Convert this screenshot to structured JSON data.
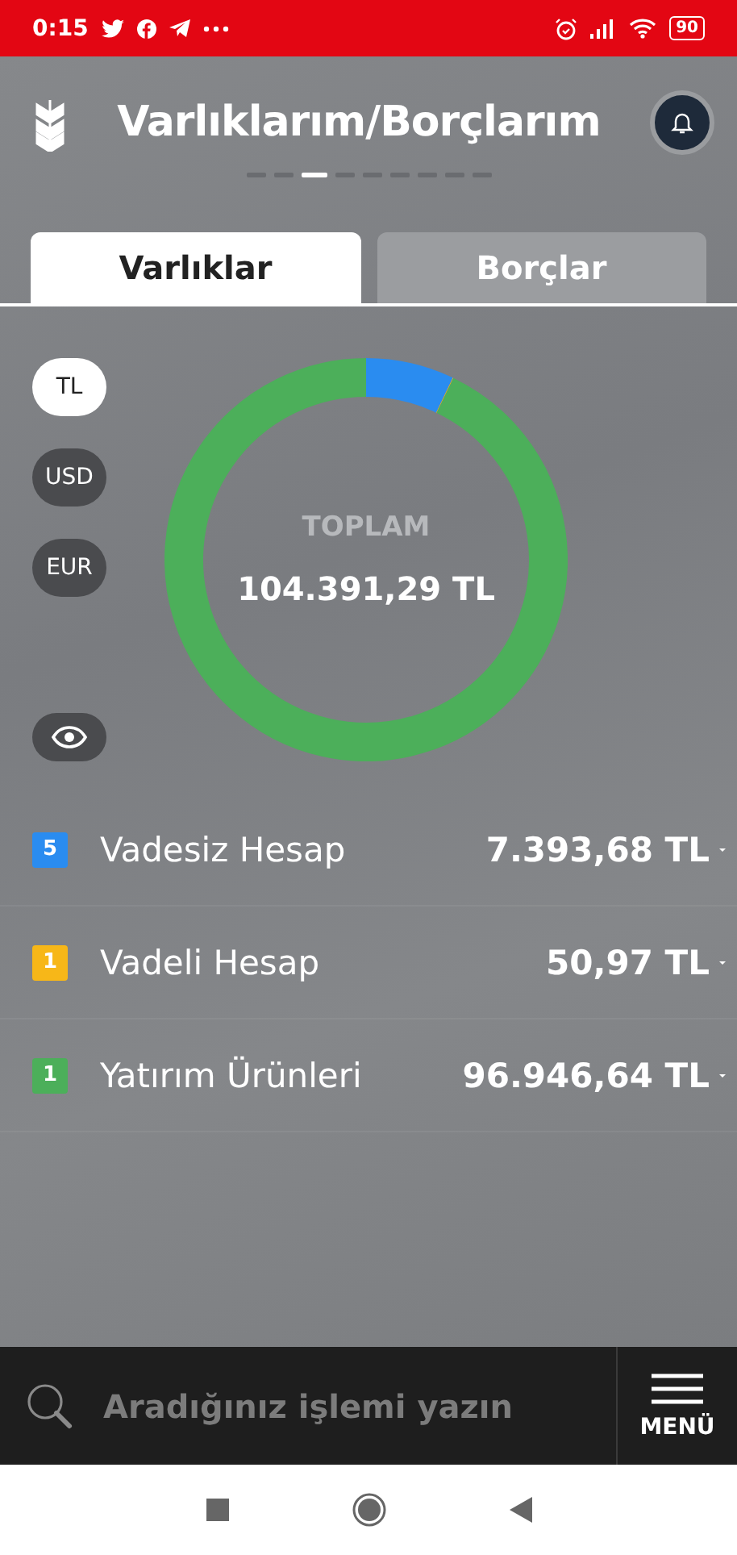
{
  "status_bar": {
    "time": "0:15",
    "battery": "90"
  },
  "header": {
    "title": "Varlıklarım/Borçlarım"
  },
  "pager": [
    {
      "selected": false
    },
    {
      "selected": false
    },
    {
      "selected": true
    },
    {
      "selected": false
    },
    {
      "selected": false
    },
    {
      "selected": false
    },
    {
      "selected": false
    },
    {
      "selected": false
    },
    {
      "selected": false
    }
  ],
  "tabs": [
    {
      "label": "Varlıklar",
      "selected": true
    },
    {
      "label": "Borçlar",
      "selected": false
    }
  ],
  "currencies": [
    {
      "label": "TL",
      "selected": true
    },
    {
      "label": "USD",
      "selected": false
    },
    {
      "label": "EUR",
      "selected": false
    }
  ],
  "total": {
    "label": "TOPLAM",
    "amount": "104.391,29 TL"
  },
  "visibility": {
    "on": true
  },
  "accounts": [
    {
      "count": "5",
      "name": "Vadesiz Hesap",
      "amount": "7.393,68 TL",
      "color": "#2a8cf0"
    },
    {
      "count": "1",
      "name": "Vadeli Hesap",
      "amount": "50,97 TL",
      "color": "#f7b718"
    },
    {
      "count": "1",
      "name": "Yatırım Ürünleri",
      "amount": "96.946,64 TL",
      "color": "#4caf5a"
    }
  ],
  "search": {
    "placeholder": "Aradığınız işlemi yazın"
  },
  "menu": {
    "label": "MENÜ"
  }
}
